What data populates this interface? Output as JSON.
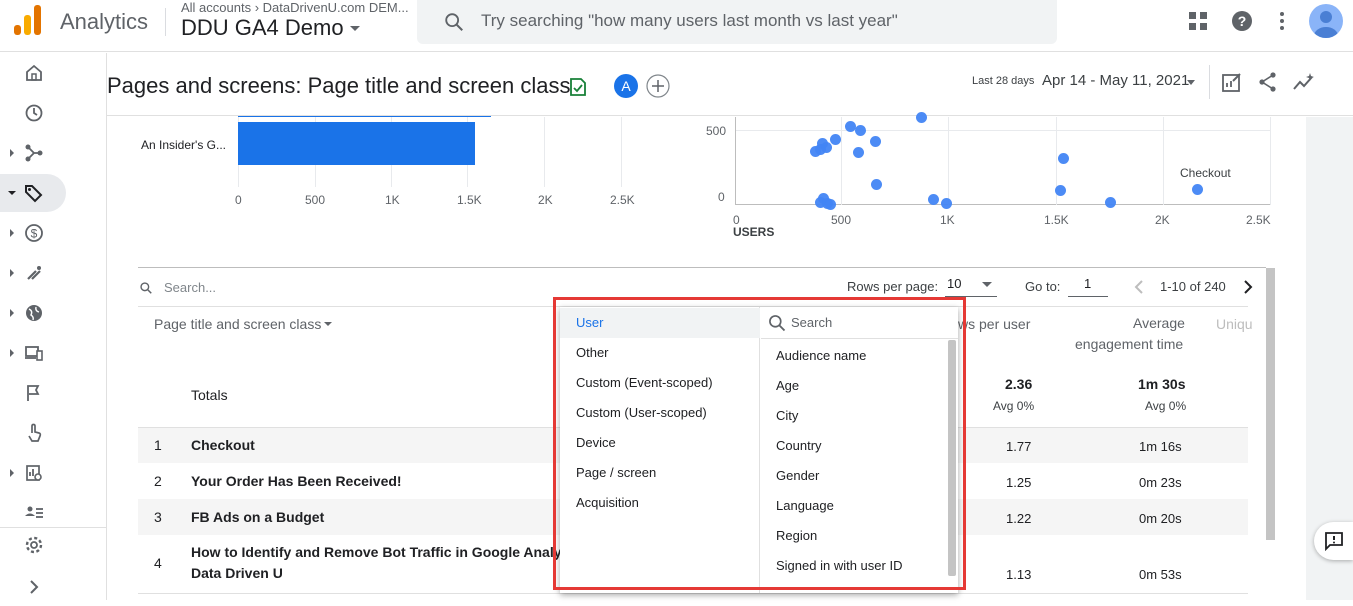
{
  "topbar": {
    "app_name": "Analytics",
    "accounts_crumb": "All accounts › DataDrivenU.com DEM...",
    "property_name": "DDU GA4 Demo",
    "search_placeholder": "Try searching \"how many users last month vs last year\""
  },
  "header": {
    "page_title": "Pages and screens: Page title and screen class",
    "comparison_avatar": "A",
    "date_label": "Last 28 days",
    "date_range": "Apr 14 - May 11, 2021"
  },
  "bar_chart": {
    "row_label": "An Insider's G...",
    "x_ticks": [
      "0",
      "500",
      "1K",
      "1.5K",
      "2K",
      "2.5K"
    ]
  },
  "scatter_chart": {
    "y_ticks": [
      "500",
      "0"
    ],
    "x_ticks": [
      "0",
      "500",
      "1K",
      "1.5K",
      "2K",
      "2.5K"
    ],
    "x_label": "USERS",
    "annotation": "Checkout"
  },
  "table": {
    "search_placeholder": "Search...",
    "rows_per_page_label": "Rows per page:",
    "rows_per_page_value": "10",
    "goto_label": "Go to:",
    "goto_value": "1",
    "page_range": "1-10 of 240",
    "dimension_header": "Page title and screen class",
    "col_views_per_user": "ws per user",
    "col_avg_engagement_l1": "Average",
    "col_avg_engagement_l2": "engagement time",
    "col_unique": "Uniqu",
    "totals_label": "Totals",
    "totals_views_per_user": "2.36",
    "totals_views_per_user_sub": "Avg 0%",
    "totals_engagement": "1m 30s",
    "totals_engagement_sub": "Avg 0%",
    "rows": [
      {
        "index": "1",
        "title": "Checkout",
        "title2": "",
        "views_per_user": "1.77",
        "engagement": "1m 16s"
      },
      {
        "index": "2",
        "title": "Your Order Has Been Received!",
        "title2": "",
        "views_per_user": "1.25",
        "engagement": "0m 23s"
      },
      {
        "index": "3",
        "title": "FB Ads on a Budget",
        "title2": "",
        "views_per_user": "1.22",
        "engagement": "0m 20s"
      },
      {
        "index": "4",
        "title": "How to Identify and Remove Bot Traffic in Google Analytics",
        "title2": "Data Driven U",
        "views_per_user": "1.13",
        "engagement": "0m 53s"
      }
    ]
  },
  "dropdown": {
    "categories": [
      "User",
      "Other",
      "Custom (Event-scoped)",
      "Custom (User-scoped)",
      "Device",
      "Page / screen",
      "Acquisition"
    ],
    "search_placeholder": "Search",
    "options": [
      "Audience name",
      "Age",
      "City",
      "Country",
      "Gender",
      "Language",
      "Region",
      "Signed in with user ID"
    ]
  },
  "colors": {
    "accent": "#1a73e8",
    "bar": "#1a73e8",
    "dot": "#4285f4",
    "highlight_outline": "#e53935"
  }
}
